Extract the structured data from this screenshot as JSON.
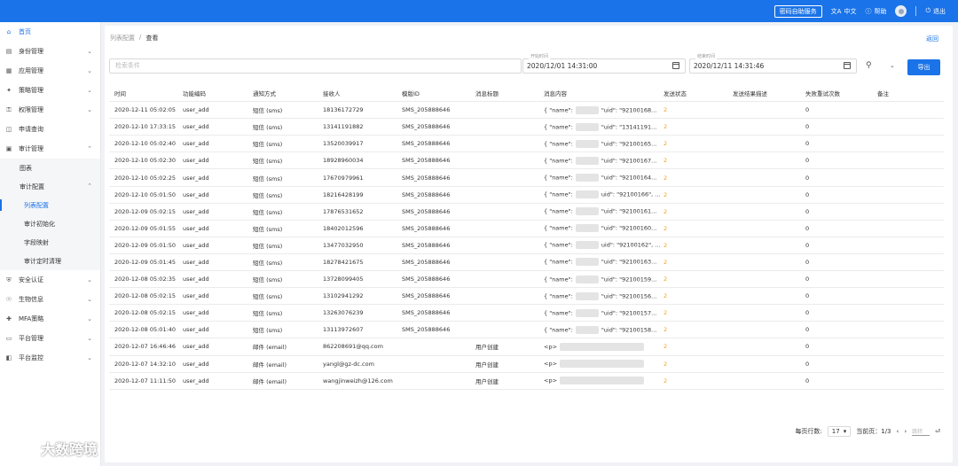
{
  "topbar": {
    "service_label": "密码自助服务",
    "lang_label": "中文",
    "help_label": "帮助",
    "logout_label": "退出"
  },
  "sidebar": {
    "items": [
      {
        "label": "首页",
        "icon": "home-icon"
      },
      {
        "label": "身份管理",
        "icon": "id-card-icon"
      },
      {
        "label": "应用管理",
        "icon": "app-icon"
      },
      {
        "label": "策略管理",
        "icon": "policy-icon"
      },
      {
        "label": "权限管理",
        "icon": "key-icon"
      },
      {
        "label": "申请查询",
        "icon": "apply-icon"
      },
      {
        "label": "审计管理",
        "icon": "audit-icon"
      }
    ],
    "audit_children": {
      "chart": "图表",
      "audit_config": "审计配置",
      "list_config": "列表配置",
      "audit_init": "审计初始化",
      "field_map": "字段映射",
      "audit_cleanup": "审计定时清理"
    },
    "items_after": [
      {
        "label": "安全认证",
        "icon": "shield-icon"
      },
      {
        "label": "生物信息",
        "icon": "fingerprint-icon"
      },
      {
        "label": "MFA策略",
        "icon": "mfa-icon"
      },
      {
        "label": "平台管理",
        "icon": "monitor-icon"
      },
      {
        "label": "平台监控",
        "icon": "dashboard-icon"
      }
    ]
  },
  "breadcrumb": {
    "parent": "列表配置",
    "separator": "/",
    "current": "查看"
  },
  "back_label": "返回",
  "filters": {
    "search_placeholder": "检索条件",
    "start_label": "开始时间",
    "start_value": "2020/12/01 14:31:00",
    "end_label": "结束时间",
    "end_value": "2020/12/11 14:31:46",
    "export_label": "导出"
  },
  "table": {
    "headers": [
      "时间",
      "功能编码",
      "通知方式",
      "接收人",
      "模版ID",
      "消息标题",
      "消息内容",
      "发送状态",
      "发送结果描述",
      "失败重试次数",
      "备注"
    ],
    "rows": [
      [
        "2020-12-11 05:02:05",
        "user_add",
        "短信 (sms)",
        "18136172729",
        "SMS_205888646",
        "",
        "{ \"name\":",
        "\"uid\": \"92100168...",
        "2",
        "",
        "0"
      ],
      [
        "2020-12-10 17:33:15",
        "user_add",
        "短信 (sms)",
        "13141191882",
        "SMS_205888646",
        "",
        "{ \"name\":",
        "\"uid\": \"13141191...",
        "2",
        "",
        "0"
      ],
      [
        "2020-12-10 05:02:40",
        "user_add",
        "短信 (sms)",
        "13520039917",
        "SMS_205888646",
        "",
        "{ \"name\":",
        "\"uid\": \"92100165...",
        "2",
        "",
        "0"
      ],
      [
        "2020-12-10 05:02:30",
        "user_add",
        "短信 (sms)",
        "18928960034",
        "SMS_205888646",
        "",
        "{ \"name\":",
        "\"uid\": \"92100167...",
        "2",
        "",
        "0"
      ],
      [
        "2020-12-10 05:02:25",
        "user_add",
        "短信 (sms)",
        "17670979961",
        "SMS_205888646",
        "",
        "{ \"name\":",
        "\"uid\": \"92100164...",
        "2",
        "",
        "0"
      ],
      [
        "2020-12-10 05:01:50",
        "user_add",
        "短信 (sms)",
        "18216428199",
        "SMS_205888646",
        "",
        "{ \"name\":",
        "uid\": \"92100166\", ...",
        "2",
        "",
        "0"
      ],
      [
        "2020-12-09 05:02:15",
        "user_add",
        "短信 (sms)",
        "17876531652",
        "SMS_205888646",
        "",
        "{ \"name\":",
        "\"uid\": \"92100161...",
        "2",
        "",
        "0"
      ],
      [
        "2020-12-09 05:01:55",
        "user_add",
        "短信 (sms)",
        "18402012596",
        "SMS_205888646",
        "",
        "{ \"name\":",
        "\"uid\": \"92100160...",
        "2",
        "",
        "0"
      ],
      [
        "2020-12-09 05:01:50",
        "user_add",
        "短信 (sms)",
        "13477032950",
        "SMS_205888646",
        "",
        "{ \"name\":",
        "uid\": \"92100162\", ...",
        "2",
        "",
        "0"
      ],
      [
        "2020-12-09 05:01:45",
        "user_add",
        "短信 (sms)",
        "18278421675",
        "SMS_205888646",
        "",
        "{ \"name\":",
        "\"uid\": \"92100163...",
        "2",
        "",
        "0"
      ],
      [
        "2020-12-08 05:02:35",
        "user_add",
        "短信 (sms)",
        "13728099405",
        "SMS_205888646",
        "",
        "{ \"name\":",
        "\"uid\": \"92100159...",
        "2",
        "",
        "0"
      ],
      [
        "2020-12-08 05:02:15",
        "user_add",
        "短信 (sms)",
        "13102941292",
        "SMS_205888646",
        "",
        "{ \"name\":",
        "\"uid\": \"92100156...",
        "2",
        "",
        "0"
      ],
      [
        "2020-12-08 05:02:15",
        "user_add",
        "短信 (sms)",
        "13263076239",
        "SMS_205888646",
        "",
        "{ \"name\":",
        "\"uid\": \"92100157...",
        "2",
        "",
        "0"
      ],
      [
        "2020-12-08 05:01:40",
        "user_add",
        "短信 (sms)",
        "13113972607",
        "SMS_205888646",
        "",
        "{ \"name\":",
        "\"uid\": \"92100158...",
        "2",
        "",
        "0"
      ],
      [
        "2020-12-07 16:46:46",
        "user_add",
        "邮件 (email)",
        "862208691@qq.com",
        "",
        "用户创建",
        "<p>",
        "",
        "2",
        "",
        "0"
      ],
      [
        "2020-12-07 14:32:10",
        "user_add",
        "邮件 (email)",
        "yangl@gz-dc.com",
        "",
        "用户创建",
        "<p>",
        "",
        "2",
        "",
        "0"
      ],
      [
        "2020-12-07 11:11:50",
        "user_add",
        "邮件 (email)",
        "wangjinweizh@126.com",
        "",
        "用户创建",
        "<p>",
        "",
        "2",
        "",
        "0"
      ]
    ]
  },
  "pager": {
    "rows_label": "每页行数:",
    "rows_value": "17",
    "page_label": "当前页：1/3",
    "jump_placeholder": "跳转"
  },
  "watermark": "大数跨境",
  "colors": {
    "primary": "#1a73e8",
    "status": "#f0a020"
  }
}
